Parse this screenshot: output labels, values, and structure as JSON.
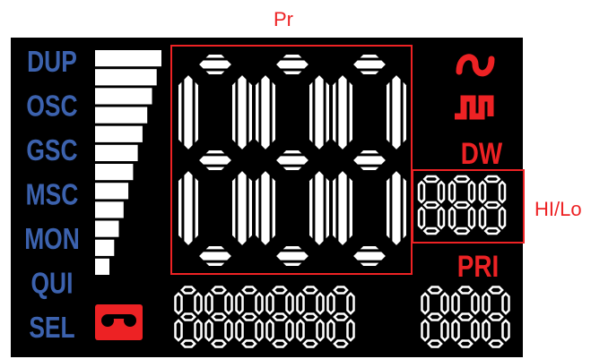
{
  "annotations": {
    "main_display": "Pr",
    "side_display": "HI/Lo"
  },
  "mode_labels": [
    "DUP",
    "OSC",
    "GSC",
    "MSC",
    "MON",
    "QUI",
    "SEL"
  ],
  "right_labels": {
    "dw": "DW",
    "pri": "PRI"
  },
  "segment_text": {
    "main_digits": "888",
    "side_digits": "888",
    "bottom_left_digits": "888888",
    "bottom_right_digits": "888"
  },
  "signal_bar": {
    "segments": 12,
    "lit": 12
  },
  "icons": {
    "sine": "sine-wave-icon",
    "square": "square-wave-icon",
    "cassette": "cassette-icon"
  },
  "colors": {
    "panel": "#000000",
    "label_blue": "#3C62AE",
    "accent_red": "#ED2224",
    "segment_white": "#ffffff",
    "callout_red": "#ED2224",
    "background": "#ffffff"
  }
}
